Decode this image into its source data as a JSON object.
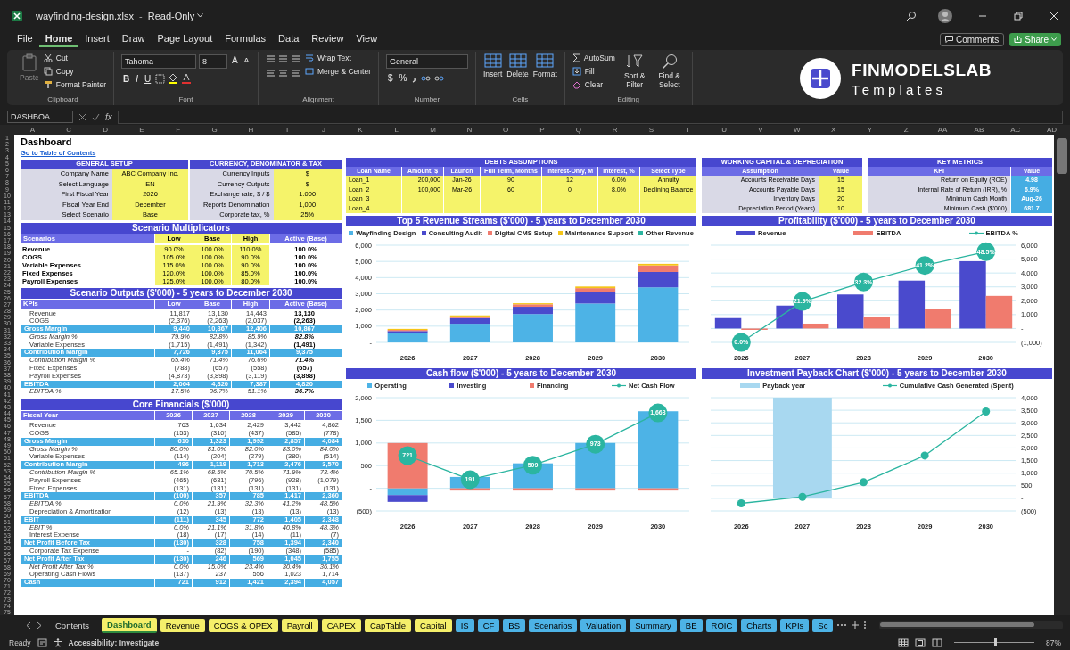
{
  "title_bar": {
    "file_name": "wayfinding-design.xlsx",
    "separator": "-",
    "mode": "Read-Only"
  },
  "menu": {
    "tabs": [
      {
        "label": "File",
        "selected": false
      },
      {
        "label": "Home",
        "selected": true
      },
      {
        "label": "Insert",
        "selected": false
      },
      {
        "label": "Draw",
        "selected": false
      },
      {
        "label": "Page Layout",
        "selected": false
      },
      {
        "label": "Formulas",
        "selected": false
      },
      {
        "label": "Data",
        "selected": false
      },
      {
        "label": "Review",
        "selected": false
      },
      {
        "label": "View",
        "selected": false
      }
    ],
    "comments": "Comments",
    "share": "Share"
  },
  "ribbon": {
    "clipboard": {
      "paste": "Paste",
      "cut": "Cut",
      "copy": "Copy",
      "format_painter": "Format Painter",
      "label": "Clipboard"
    },
    "font": {
      "name": "Tahoma",
      "size": "8",
      "grow": "A",
      "shrink": "A",
      "styles": [
        "B",
        "I",
        "U"
      ],
      "label": "Font"
    },
    "alignment": {
      "wrap": "Wrap Text",
      "merge": "Merge & Center",
      "label": "Alignment"
    },
    "number": {
      "format": "General",
      "symbols": [
        "$",
        "%"
      ],
      "label": "Number"
    },
    "cells": {
      "buttons": [
        "Insert",
        "Delete",
        "Format"
      ],
      "label": "Cells"
    },
    "editing": {
      "autosum": "AutoSum",
      "fill": "Fill",
      "clear": "Clear",
      "sort": "Sort & Filter",
      "find": "Find & Select",
      "label": "Editing"
    },
    "logo": {
      "name": "FINMODELSLAB",
      "tagline": "Templates"
    }
  },
  "formula_bar": {
    "name_box": "DASHBOA...",
    "fx": "fx"
  },
  "column_headers": [
    "A",
    "C",
    "D",
    "E",
    "F",
    "G",
    "H",
    "I",
    "J",
    "K",
    "L",
    "M",
    "N",
    "O",
    "P",
    "Q",
    "R",
    "S",
    "T",
    "U",
    "V",
    "W",
    "X",
    "Y",
    "Z",
    "AA",
    "AB",
    "AC",
    "AD"
  ],
  "row_numbers": [
    "1",
    "2",
    "3",
    "4",
    "5",
    "6",
    "7",
    "8",
    "9",
    "10",
    "11",
    "12",
    "13",
    "14",
    "15",
    "16",
    "17",
    "18",
    "19",
    "20",
    "21",
    "22",
    "23",
    "24",
    "25",
    "26",
    "27",
    "28",
    "29",
    "30",
    "31",
    "32",
    "33",
    "34",
    "35",
    "36",
    "37",
    "38",
    "39",
    "40",
    "41",
    "42",
    "43",
    "44",
    "45",
    "46",
    "47",
    "48",
    "49",
    "50",
    "51",
    "52",
    "53",
    "54",
    "55",
    "56",
    "57",
    "58",
    "59",
    "60",
    "61",
    "62",
    "63",
    "64",
    "65",
    "66",
    "67",
    "68",
    "69",
    "70",
    "71",
    "72",
    "73",
    "74",
    "75"
  ],
  "dashboard": {
    "title": "Dashboard",
    "toc_link": "Go to Table of Contents",
    "general_setup": {
      "title": "GENERAL SETUP",
      "rows": [
        {
          "label": "Company Name",
          "value": "ABC Company Inc."
        },
        {
          "label": "Select Language",
          "value": "EN"
        },
        {
          "label": "First Fiscal Year",
          "value": "2026"
        },
        {
          "label": "Fiscal Year End",
          "value": "December"
        },
        {
          "label": "Select Scenario",
          "value": "Base"
        }
      ]
    },
    "currency_tax": {
      "title": "CURRENCY, DENOMINATOR & TAX",
      "rows": [
        {
          "label": "Currency Inputs",
          "value": "$"
        },
        {
          "label": "Currency Outputs",
          "value": "$"
        },
        {
          "label": "Exchange rate, $ / $",
          "value": "1.000"
        },
        {
          "label": "Reports Denomination",
          "value": "1,000"
        },
        {
          "label": "Corporate tax, %",
          "value": "25%"
        }
      ]
    },
    "debts": {
      "title": "DEBTS ASSUMPTIONS",
      "columns": [
        "Loan Name",
        "Amount, $",
        "Launch",
        "Full Term, Months",
        "Interest-Only, M",
        "Interest, %",
        "Select Type"
      ],
      "rows": [
        {
          "cells": [
            "Loan_1",
            "200,000",
            "Jan-26",
            "90",
            "12",
            "6.0%",
            "Annuity"
          ]
        },
        {
          "cells": [
            "Loan_2",
            "100,000",
            "Mar-26",
            "60",
            "0",
            "8.0%",
            "Declining Balance"
          ]
        },
        {
          "cells": [
            "Loan_3"
          ]
        },
        {
          "cells": [
            "Loan_4"
          ]
        }
      ]
    },
    "working_capital": {
      "title": "WORKING CAPITAL & DEPRECIATION",
      "columns": [
        "Assumption",
        "Value"
      ],
      "rows": [
        {
          "label": "Accounts Receivable Days",
          "value": "15"
        },
        {
          "label": "Accounts Payable Days",
          "value": "15"
        },
        {
          "label": "Inventory Days",
          "value": "20"
        },
        {
          "label": "Depreciation Period (Years)",
          "value": "10"
        }
      ]
    },
    "key_metrics": {
      "title": "KEY METRICS",
      "columns": [
        "KPI",
        "Value"
      ],
      "rows": [
        {
          "label": "Return on Equity (ROE)",
          "value": "4.98"
        },
        {
          "label": "Internal Rate of Return (IRR), %",
          "value": "6.9%"
        },
        {
          "label": "Minimum Cash Month",
          "value": "Aug-26"
        },
        {
          "label": "Minimum Cash ($'000)",
          "value": "681.7"
        }
      ]
    },
    "scenario_multiplicators": {
      "title": "Scenario Multiplicators",
      "columns": [
        {
          "label": "Scenarios",
          "highlighted": false
        },
        {
          "label": "Low",
          "highlighted": true
        },
        {
          "label": "Base",
          "highlighted": true
        },
        {
          "label": "High",
          "highlighted": true
        },
        {
          "label": "Active (Base)",
          "highlighted": false
        }
      ],
      "rows": [
        {
          "cells": [
            "Revenue",
            "90.0%",
            "100.0%",
            "110.0%",
            "100.0%"
          ]
        },
        {
          "cells": [
            "COGS",
            "105.0%",
            "100.0%",
            "90.0%",
            "100.0%"
          ]
        },
        {
          "cells": [
            "Variable Expenses",
            "115.0%",
            "100.0%",
            "90.0%",
            "100.0%"
          ]
        },
        {
          "cells": [
            "Fixed Expenses",
            "120.0%",
            "100.0%",
            "85.0%",
            "100.0%"
          ]
        },
        {
          "cells": [
            "Payroll Expenses",
            "125.0%",
            "100.0%",
            "80.0%",
            "100.0%"
          ]
        }
      ]
    },
    "scenario_outputs": {
      "title": "Scenario Outputs ($'000) - 5 years to December 2030",
      "columns": [
        "KPIs",
        "Low",
        "Base",
        "High",
        "Active (Base)"
      ],
      "rows": [
        {
          "kind": "line",
          "cells": [
            "Revenue",
            "11,817",
            "13,130",
            "14,443",
            "13,130"
          ]
        },
        {
          "kind": "line",
          "cells": [
            "COGS",
            "(2,376)",
            "(2,263)",
            "(2,037)",
            "(2,263)"
          ]
        },
        {
          "kind": "total",
          "cells": [
            "Gross Margin",
            "9,440",
            "10,867",
            "12,406",
            "10,867"
          ]
        },
        {
          "kind": "pct",
          "cells": [
            "Gross Margin %",
            "79.9%",
            "82.8%",
            "85.9%",
            "82.8%"
          ]
        },
        {
          "kind": "line",
          "cells": [
            "Variable Expenses",
            "(1,715)",
            "(1,491)",
            "(1,342)",
            "(1,491)"
          ]
        },
        {
          "kind": "total",
          "cells": [
            "Contribution Margin",
            "7,726",
            "9,375",
            "11,064",
            "9,375"
          ]
        },
        {
          "kind": "pct",
          "cells": [
            "Contribution Margin %",
            "65.4%",
            "71.4%",
            "76.6%",
            "71.4%"
          ]
        },
        {
          "kind": "line",
          "cells": [
            "Fixed Expenses",
            "(788)",
            "(657)",
            "(558)",
            "(657)"
          ]
        },
        {
          "kind": "line",
          "cells": [
            "Payroll Expenses",
            "(4,873)",
            "(3,898)",
            "(3,119)",
            "(3,898)"
          ]
        },
        {
          "kind": "total",
          "cells": [
            "EBITDA",
            "2,064",
            "4,820",
            "7,387",
            "4,820"
          ]
        },
        {
          "kind": "pct",
          "cells": [
            "EBITDA %",
            "17.5%",
            "36.7%",
            "51.1%",
            "36.7%"
          ]
        }
      ]
    },
    "core_financials": {
      "title": "Core Financials ($'000)",
      "columns": [
        "Fiscal Year",
        "2026",
        "2027",
        "2028",
        "2029",
        "2030"
      ],
      "rows": [
        {
          "kind": "line",
          "cells": [
            "Revenue",
            "763",
            "1,634",
            "2,429",
            "3,442",
            "4,862"
          ]
        },
        {
          "kind": "line",
          "cells": [
            "COGS",
            "(153)",
            "(310)",
            "(437)",
            "(585)",
            "(778)"
          ]
        },
        {
          "kind": "total",
          "cells": [
            "Gross Margin",
            "610",
            "1,323",
            "1,992",
            "2,857",
            "4,084"
          ]
        },
        {
          "kind": "pct",
          "cells": [
            "Gross Margin %",
            "80.0%",
            "81.0%",
            "82.0%",
            "83.0%",
            "84.0%"
          ]
        },
        {
          "kind": "line",
          "cells": [
            "Variable Expenses",
            "(114)",
            "(204)",
            "(279)",
            "(380)",
            "(514)"
          ]
        },
        {
          "kind": "total",
          "cells": [
            "Contribution Margin",
            "496",
            "1,119",
            "1,713",
            "2,476",
            "3,570"
          ]
        },
        {
          "kind": "pct",
          "cells": [
            "Contribution Margin %",
            "65.1%",
            "68.5%",
            "70.5%",
            "71.9%",
            "73.4%"
          ]
        },
        {
          "kind": "line",
          "cells": [
            "Payroll Expenses",
            "(465)",
            "(631)",
            "(796)",
            "(928)",
            "(1,079)"
          ]
        },
        {
          "kind": "line",
          "cells": [
            "Fixed Expenses",
            "(131)",
            "(131)",
            "(131)",
            "(131)",
            "(131)"
          ]
        },
        {
          "kind": "total",
          "cells": [
            "EBITDA",
            "(100)",
            "357",
            "785",
            "1,417",
            "2,360"
          ]
        },
        {
          "kind": "pct",
          "cells": [
            "EBITDA %",
            "0.0%",
            "21.9%",
            "32.3%",
            "41.2%",
            "48.5%"
          ]
        },
        {
          "kind": "line",
          "cells": [
            "Depreciation & Amortization",
            "(12)",
            "(13)",
            "(13)",
            "(13)",
            "(13)"
          ]
        },
        {
          "kind": "total",
          "cells": [
            "EBIT",
            "(111)",
            "345",
            "772",
            "1,405",
            "2,348"
          ]
        },
        {
          "kind": "pct",
          "cells": [
            "EBIT %",
            "0.0%",
            "21.1%",
            "31.8%",
            "40.8%",
            "48.3%"
          ]
        },
        {
          "kind": "line",
          "cells": [
            "Interest Expense",
            "(18)",
            "(17)",
            "(14)",
            "(11)",
            "(7)"
          ]
        },
        {
          "kind": "total",
          "cells": [
            "Net Profit Before Tax",
            "(130)",
            "328",
            "758",
            "1,394",
            "2,340"
          ]
        },
        {
          "kind": "line",
          "cells": [
            "Corporate Tax Expense",
            "-",
            "(82)",
            "(190)",
            "(348)",
            "(585)"
          ]
        },
        {
          "kind": "total",
          "cells": [
            "Net Profit After Tax",
            "(130)",
            "246",
            "569",
            "1,045",
            "1,755"
          ]
        },
        {
          "kind": "pct",
          "cells": [
            "Net Profit After Tax %",
            "0.0%",
            "15.0%",
            "23.4%",
            "30.4%",
            "36.1%"
          ]
        },
        {
          "kind": "line",
          "cells": [
            "Operating Cash Flows",
            "(137)",
            "237",
            "556",
            "1,023",
            "1,714"
          ]
        },
        {
          "kind": "total",
          "cells": [
            "Cash",
            "721",
            "912",
            "1,421",
            "2,394",
            "4,057"
          ]
        }
      ]
    },
    "charts": [
      {
        "title": "Top 5 Revenue Streams ($'000) - 5 years to December 2030",
        "chart_data": {
          "type": "bar",
          "stacked": true,
          "categories": [
            "2026",
            "2027",
            "2028",
            "2029",
            "2030"
          ],
          "grid": true,
          "ylim": [
            0,
            6000
          ],
          "yticks": [
            {
              "value": 0,
              "label": "-"
            },
            {
              "value": 1000,
              "label": "1,000"
            },
            {
              "value": 2000,
              "label": "2,000"
            },
            {
              "value": 3000,
              "label": "3,000"
            },
            {
              "value": 4000,
              "label": "4,000"
            },
            {
              "value": 5000,
              "label": "5,000"
            },
            {
              "value": 6000,
              "label": "6,000"
            }
          ],
          "series": [
            {
              "name": "Wayfinding Design",
              "color": "#4db3e6",
              "values": [
                550,
                1150,
                1750,
                2400,
                3400
              ]
            },
            {
              "name": "Consulting Audit",
              "color": "#4a4acd",
              "values": [
                150,
                350,
                450,
                700,
                950
              ]
            },
            {
              "name": "Digital CMS Setup",
              "color": "#f07b6e",
              "values": [
                50,
                100,
                150,
                250,
                400
              ]
            },
            {
              "name": "Maintenance Support",
              "color": "#f5c518",
              "values": [
                50,
                50,
                50,
                100,
                100
              ]
            },
            {
              "name": "Other Revenue",
              "color": "#2bb5a0",
              "values": [
                0,
                0,
                0,
                0,
                0
              ]
            }
          ]
        }
      },
      {
        "title": "Profitability ($'000) - 5 years to December 2030",
        "chart_data": {
          "type": "bar",
          "stacked": false,
          "categories": [
            "2026",
            "2027",
            "2028",
            "2029",
            "2030"
          ],
          "grid": true,
          "y2lim": [
            0,
            52
          ],
          "ylim": [
            -1000,
            6000
          ],
          "yticks": [
            {
              "value": -1000,
              "label": "(1,000)"
            },
            {
              "value": 0,
              "label": "-"
            },
            {
              "value": 1000,
              "label": "1,000"
            },
            {
              "value": 2000,
              "label": "2,000"
            },
            {
              "value": 3000,
              "label": "3,000"
            },
            {
              "value": 4000,
              "label": "4,000"
            },
            {
              "value": 5000,
              "label": "5,000"
            },
            {
              "value": 6000,
              "label": "6,000"
            }
          ],
          "series": [
            {
              "name": "Revenue",
              "color": "#4a4acd",
              "values": [
                750,
                1650,
                2450,
                3450,
                4850
              ]
            },
            {
              "name": "EBITDA",
              "color": "#f07b6e",
              "values": [
                -100,
                350,
                800,
                1400,
                2350
              ]
            },
            {
              "name": "EBITDA %",
              "type": "line",
              "axis": "y2",
              "marker": true,
              "color": "#2bb5a0",
              "values": [
                0,
                21.9,
                32.3,
                41.2,
                48.5
              ],
              "value_labels": [
                "0.0%",
                "21.9%",
                "32.3%",
                "41.2%",
                "48.5%"
              ]
            }
          ]
        }
      },
      {
        "title": "Cash flow ($'000) - 5 years to December 2030",
        "chart_data": {
          "type": "bar",
          "stacked": true,
          "categories": [
            "2026",
            "2027",
            "2028",
            "2029",
            "2030"
          ],
          "grid": true,
          "ylim": [
            -500,
            2000
          ],
          "yticks": [
            {
              "value": -500,
              "label": "(500)"
            },
            {
              "value": 0,
              "label": "-"
            },
            {
              "value": 500,
              "label": "500"
            },
            {
              "value": 1000,
              "label": "1,000"
            },
            {
              "value": 1500,
              "label": "1,500"
            },
            {
              "value": 2000,
              "label": "2,000"
            }
          ],
          "series": [
            {
              "name": "Operating",
              "color": "#4db3e6",
              "values": [
                -150,
                250,
                550,
                1000,
                1700
              ]
            },
            {
              "name": "Investing",
              "color": "#4a4acd",
              "values": [
                -150,
                0,
                0,
                0,
                0
              ]
            },
            {
              "name": "Financing",
              "color": "#f07b6e",
              "values": [
                1000,
                -50,
                -50,
                -50,
                -50
              ]
            },
            {
              "name": "Net Cash Flow",
              "type": "line",
              "marker": true,
              "color": "#2bb5a0",
              "values": [
                721,
                191,
                509,
                973,
                1663
              ],
              "value_labels": [
                "721",
                "191",
                "509",
                "973",
                "1,663"
              ]
            }
          ]
        }
      },
      {
        "title": "Investment Payback Chart ($'000) - 5 years to December 2030",
        "chart_data": {
          "type": "bar",
          "stacked": false,
          "categories": [
            "2026",
            "2027",
            "2028",
            "2029",
            "2030"
          ],
          "grid": true,
          "ylim": [
            -500,
            4000
          ],
          "yticks": [
            {
              "value": -500,
              "label": "(500)"
            },
            {
              "value": 0,
              "label": "-"
            },
            {
              "value": 500,
              "label": "500"
            },
            {
              "value": 1000,
              "label": "1,000"
            },
            {
              "value": 1500,
              "label": "1,500"
            },
            {
              "value": 2000,
              "label": "2,000"
            },
            {
              "value": 2500,
              "label": "2,500"
            },
            {
              "value": 3000,
              "label": "3,000"
            },
            {
              "value": 3500,
              "label": "3,500"
            },
            {
              "value": 4000,
              "label": "4,000"
            }
          ],
          "series": [
            {
              "name": "Payback year",
              "color": "#a8d8f0",
              "values": [
                null,
                4000,
                null,
                null,
                null
              ]
            },
            {
              "name": "Cumulative Cash Generated (Spent)",
              "type": "line",
              "marker": true,
              "color": "#2bb5a0",
              "values": [
                -200,
                60,
                640,
                1700,
                3450
              ]
            }
          ]
        }
      }
    ]
  },
  "sheet_tabs": [
    {
      "label": "Contents",
      "selected": false
    },
    {
      "label": "Dashboard",
      "selected": true,
      "color": "#f5ef6a"
    },
    {
      "label": "Revenue",
      "selected": false,
      "color": "#f5ef6a"
    },
    {
      "label": "COGS & OPEX",
      "selected": false,
      "color": "#f5ef6a"
    },
    {
      "label": "Payroll",
      "selected": false,
      "color": "#f5ef6a"
    },
    {
      "label": "CAPEX",
      "selected": false,
      "color": "#f5ef6a"
    },
    {
      "label": "CapTable",
      "selected": false,
      "color": "#f5ef6a"
    },
    {
      "label": "Capital",
      "selected": false,
      "color": "#f5ef6a"
    },
    {
      "label": "IS",
      "selected": false,
      "color": "#4db3e6"
    },
    {
      "label": "CF",
      "selected": false,
      "color": "#4db3e6"
    },
    {
      "label": "BS",
      "selected": false,
      "color": "#4db3e6"
    },
    {
      "label": "Scenarios",
      "selected": false,
      "color": "#4db3e6"
    },
    {
      "label": "Valuation",
      "selected": false,
      "color": "#4db3e6"
    },
    {
      "label": "Summary",
      "selected": false,
      "color": "#4db3e6"
    },
    {
      "label": "BE",
      "selected": false,
      "color": "#4db3e6"
    },
    {
      "label": "ROIC",
      "selected": false,
      "color": "#4db3e6"
    },
    {
      "label": "Charts",
      "selected": false,
      "color": "#4db3e6"
    },
    {
      "label": "KPIs",
      "selected": false,
      "color": "#4db3e6"
    },
    {
      "label": "Sc",
      "selected": false,
      "color": "#4db3e6"
    }
  ],
  "status_bar": {
    "status": "Ready",
    "accessibility": "Accessibility: Investigate",
    "zoom": "87%",
    "zoom_slider": {
      "level": 0.5
    }
  }
}
